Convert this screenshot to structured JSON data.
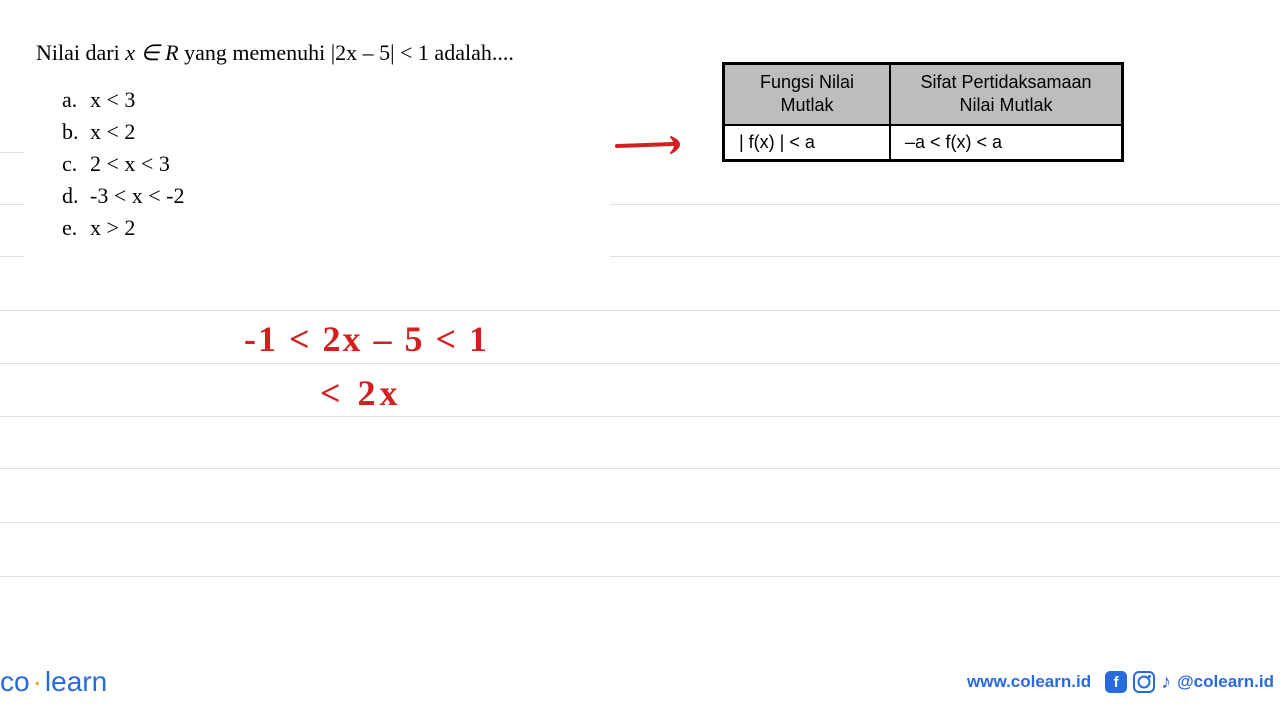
{
  "question": {
    "prefix": "Nilai dari ",
    "var": "x ∈ R",
    "mid": " yang memenuhi |2x – 5| < 1 adalah...."
  },
  "options": [
    {
      "label": "a.",
      "text": "x < 3"
    },
    {
      "label": "b.",
      "text": "x < 2"
    },
    {
      "label": "c.",
      "text": "2 < x < 3"
    },
    {
      "label": "d.",
      "text": "-3 < x < -2"
    },
    {
      "label": "e.",
      "text": "x > 2"
    }
  ],
  "table": {
    "header1_line1": "Fungsi Nilai",
    "header1_line2": "Mutlak",
    "header2_line1": "Sifat Pertidaksamaan",
    "header2_line2": "Nilai Mutlak",
    "cell1": "| f(x) | < a",
    "cell2": "–a < f(x) < a"
  },
  "handwriting": {
    "line1": "-1 < 2x – 5 < 1",
    "line2": "<   2x"
  },
  "footer": {
    "logo_co": "co",
    "logo_learn": "learn",
    "url": "www.colearn.id",
    "handle": "@colearn.id"
  },
  "colors": {
    "red": "#d21f1f",
    "blue": "#2a6adf",
    "grey": "#bdbdbd"
  }
}
